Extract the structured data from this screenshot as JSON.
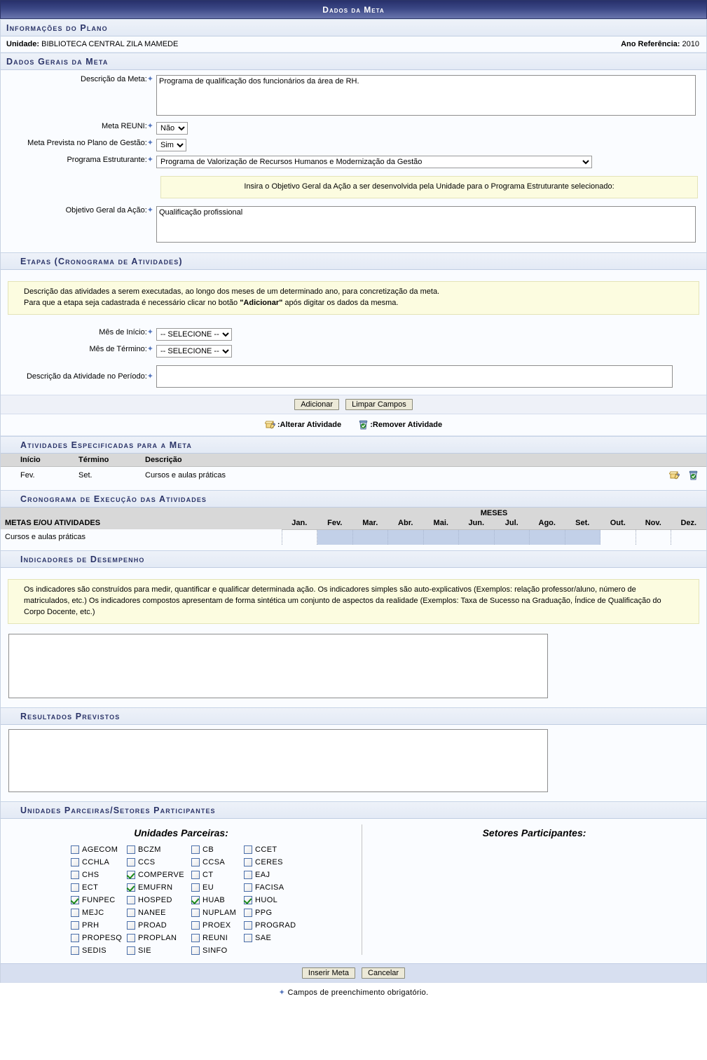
{
  "window": {
    "title": "Dados da Meta"
  },
  "sections": {
    "info_plano": "Informações do Plano",
    "dados_gerais": "Dados Gerais da Meta",
    "etapas": "Etapas (Cronograma de Atividades)",
    "atividades_especificadas": "Atividades Especificadas para a Meta",
    "cronograma_execucao": "Cronograma de Execução das Atividades",
    "indicadores": "Indicadores de Desempenho",
    "resultados": "Resultados Previstos",
    "unidades_setores": "Unidades Parceiras/Setores Participantes"
  },
  "plano": {
    "unidade_label": "Unidade:",
    "unidade_value": "BIBLIOTECA CENTRAL ZILA MAMEDE",
    "ano_label": "Ano Referência:",
    "ano_value": "2010"
  },
  "dados_gerais": {
    "descricao_label": "Descrição da Meta:",
    "descricao_value": "Programa de qualificação dos funcionários da área de RH.",
    "meta_reuni_label": "Meta REUNI:",
    "meta_reuni_value": "Não",
    "meta_reuni_options": [
      "Sim",
      "Não"
    ],
    "meta_prevista_label": "Meta Prevista no Plano de Gestão:",
    "meta_prevista_value": "Sim",
    "meta_prevista_options": [
      "Sim",
      "Não"
    ],
    "programa_label": "Programa Estruturante:",
    "programa_value": "Programa de Valorização de Recursos Humanos e Modernização da Gestão",
    "objetivo_notice": "Insira o Objetivo Geral da Ação a ser desenvolvida pela Unidade para o Programa Estruturante selecionado:",
    "objetivo_label": "Objetivo Geral da Ação:",
    "objetivo_value": "Qualificação profissional"
  },
  "etapas": {
    "notice_line1": "Descrição das atividades a serem executadas, ao longo dos meses de um determinado ano, para concretização da meta.",
    "notice_line2_pre": "Para que a etapa seja cadastrada é necessário clicar no botão ",
    "notice_line2_bold": "\"Adicionar\"",
    "notice_line2_post": " após digitar os dados da mesma.",
    "mes_inicio_label": "Mês de Início:",
    "mes_inicio_value": "-- SELECIONE --",
    "mes_termino_label": "Mês de Término:",
    "mes_termino_value": "-- SELECIONE --",
    "mes_options": [
      "-- SELECIONE --",
      "Jan.",
      "Fev.",
      "Mar.",
      "Abr.",
      "Mai.",
      "Jun.",
      "Jul.",
      "Ago.",
      "Set.",
      "Out.",
      "Nov.",
      "Dez."
    ],
    "descricao_atividade_label": "Descrição da Atividade no Período:",
    "descricao_atividade_value": "",
    "btn_adicionar": "Adicionar",
    "btn_limpar": "Limpar Campos"
  },
  "legend": {
    "alterar": ":Alterar Atividade",
    "remover": ":Remover Atividade"
  },
  "atividades_table": {
    "headers": [
      "Início",
      "Término",
      "Descrição"
    ],
    "rows": [
      {
        "inicio": "Fev.",
        "termino": "Set.",
        "descricao": "Cursos e aulas práticas"
      }
    ]
  },
  "cronograma": {
    "col_metas": "METAS E/OU ATIVIDADES",
    "meses_label": "MESES",
    "months": [
      "Jan.",
      "Fev.",
      "Mar.",
      "Abr.",
      "Mai.",
      "Jun.",
      "Jul.",
      "Ago.",
      "Set.",
      "Out.",
      "Nov.",
      "Dez."
    ],
    "rows": [
      {
        "name": "Cursos e aulas práticas",
        "active": [
          false,
          true,
          true,
          true,
          true,
          true,
          true,
          true,
          true,
          false,
          false,
          false
        ]
      }
    ]
  },
  "indicadores": {
    "notice": "Os indicadores são construídos para medir, quantificar e qualificar determinada ação. Os indicadores simples são auto-explicativos (Exemplos: relação professor/aluno, número de matriculados, etc.) Os indicadores compostos apresentam de forma sintética um conjunto de aspectos da realidade (Exemplos: Taxa de Sucesso na Graduação, Índice de Qualificação do Corpo Docente, etc.)",
    "value": ""
  },
  "resultados": {
    "value": ""
  },
  "parceiras": {
    "title_unidades": "Unidades Parceiras:",
    "title_setores": "Setores Participantes:",
    "items": [
      {
        "label": "AGECOM",
        "checked": false
      },
      {
        "label": "BCZM",
        "checked": false
      },
      {
        "label": "CB",
        "checked": false
      },
      {
        "label": "CCET",
        "checked": false
      },
      {
        "label": "CCHLA",
        "checked": false
      },
      {
        "label": "CCS",
        "checked": false
      },
      {
        "label": "CCSA",
        "checked": false
      },
      {
        "label": "CERES",
        "checked": false
      },
      {
        "label": "CHS",
        "checked": false
      },
      {
        "label": "COMPERVE",
        "checked": true
      },
      {
        "label": "CT",
        "checked": false
      },
      {
        "label": "EAJ",
        "checked": false
      },
      {
        "label": "ECT",
        "checked": false
      },
      {
        "label": "EMUFRN",
        "checked": true
      },
      {
        "label": "EU",
        "checked": false
      },
      {
        "label": "FACISA",
        "checked": false
      },
      {
        "label": "FUNPEC",
        "checked": true
      },
      {
        "label": "HOSPED",
        "checked": false
      },
      {
        "label": "HUAB",
        "checked": true
      },
      {
        "label": "HUOL",
        "checked": true
      },
      {
        "label": "MEJC",
        "checked": false
      },
      {
        "label": "NANEE",
        "checked": false
      },
      {
        "label": "NUPLAM",
        "checked": false
      },
      {
        "label": "PPG",
        "checked": false
      },
      {
        "label": "PRH",
        "checked": false
      },
      {
        "label": "PROAD",
        "checked": false
      },
      {
        "label": "PROEX",
        "checked": false
      },
      {
        "label": "PROGRAD",
        "checked": false
      },
      {
        "label": "PROPESQ",
        "checked": false
      },
      {
        "label": "PROPLAN",
        "checked": false
      },
      {
        "label": "REUNI",
        "checked": false
      },
      {
        "label": "SAE",
        "checked": false
      },
      {
        "label": "SEDIS",
        "checked": false
      },
      {
        "label": "SIE",
        "checked": false
      },
      {
        "label": "SINFO",
        "checked": false
      }
    ]
  },
  "footer": {
    "btn_inserir": "Inserir Meta",
    "btn_cancelar": "Cancelar",
    "obrigatorio": "Campos de preenchimento obrigatório."
  },
  "colors": {
    "titlebar_dark": "#27306b",
    "titlebar_light": "#6a76ae",
    "subtitle_text": "#2b3468",
    "notice_bg": "#fcfce0",
    "gantt_fill": "#c2d0e8",
    "table_header": "#d8d8d8",
    "required_star": "#5878be"
  }
}
